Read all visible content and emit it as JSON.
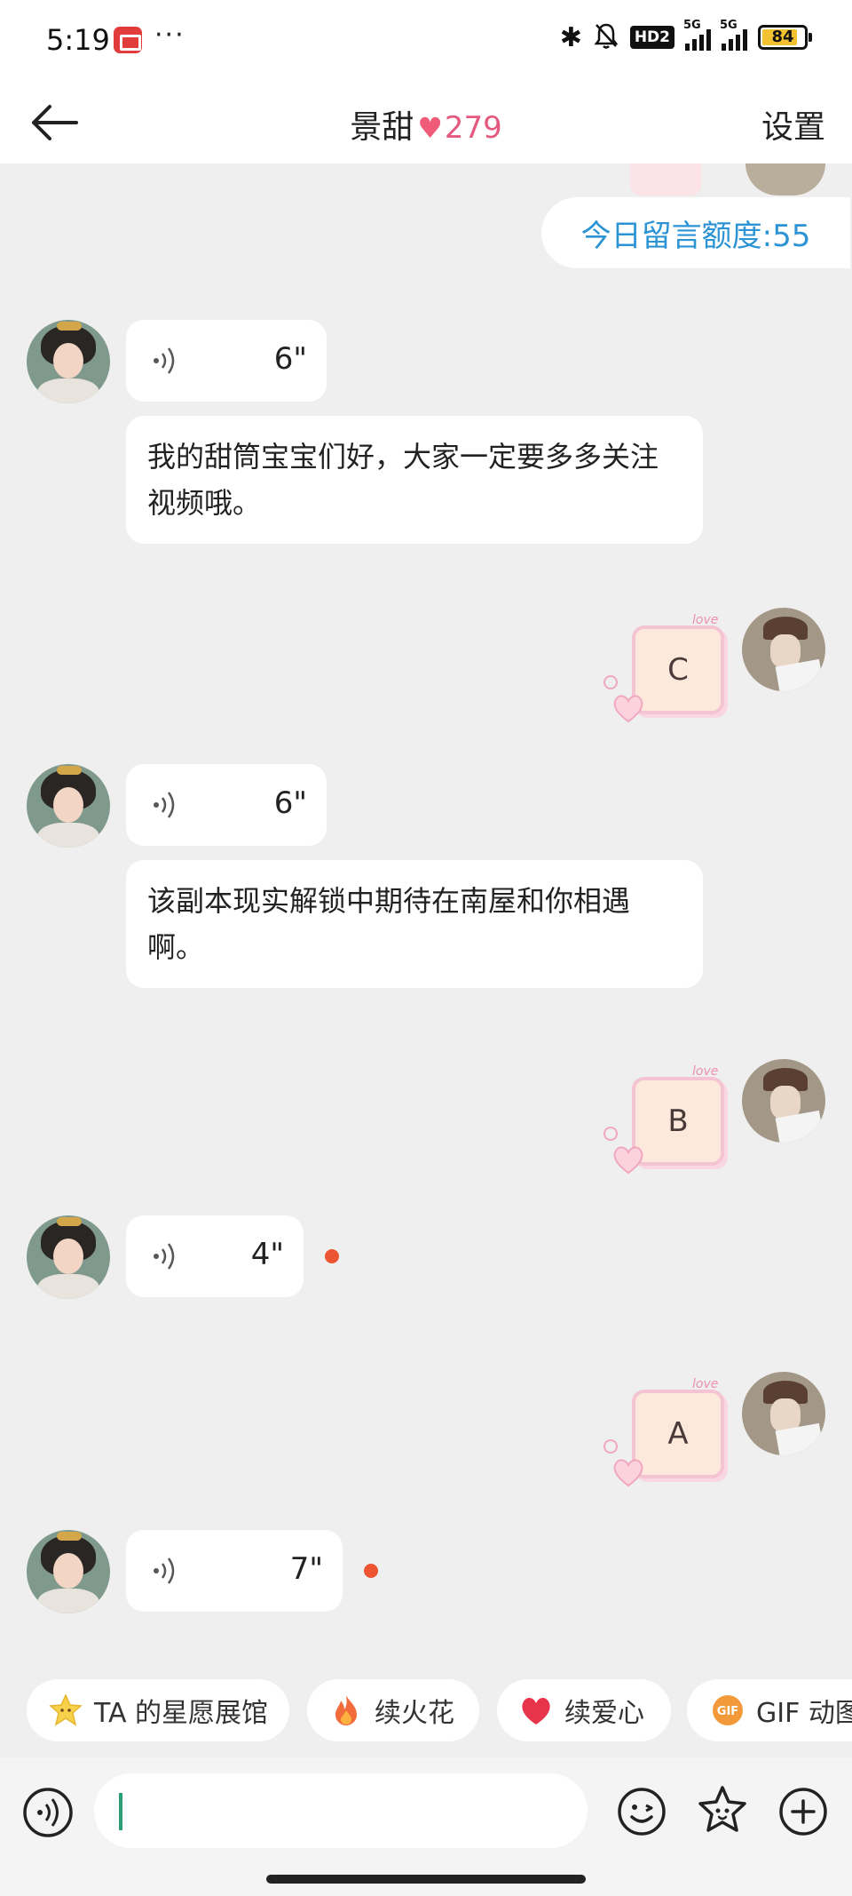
{
  "status_bar": {
    "time": "5:19",
    "dots": "···",
    "hd": "HD2",
    "net": "5G",
    "battery": "84",
    "battery_level": 0.84
  },
  "nav": {
    "title": "景甜",
    "heart_count": "279",
    "settings_label": "设置"
  },
  "quota": {
    "label": "今日留言额度:55"
  },
  "messages": [
    {
      "type": "voice",
      "side": "left",
      "duration": "6\""
    },
    {
      "type": "text",
      "side": "left",
      "text": "我的甜筒宝宝们好，大家一定要多多关注视频哦。"
    },
    {
      "type": "sticker",
      "side": "right",
      "letter": "C"
    },
    {
      "type": "voice",
      "side": "left",
      "duration": "6\""
    },
    {
      "type": "text",
      "side": "left",
      "text": "该副本现实解锁中期待在南屋和你相遇啊。"
    },
    {
      "type": "sticker",
      "side": "right",
      "letter": "B"
    },
    {
      "type": "voice",
      "side": "left",
      "duration": "4\"",
      "unread": true
    },
    {
      "type": "sticker",
      "side": "right",
      "letter": "A"
    },
    {
      "type": "voice",
      "side": "left",
      "duration": "7\"",
      "unread": true
    }
  ],
  "sticker_deco": "love",
  "quick_actions": [
    {
      "label": "TA 的星愿展馆",
      "icon": "star-icon"
    },
    {
      "label": "续火花",
      "icon": "fire-icon"
    },
    {
      "label": "续爱心",
      "icon": "heart-icon"
    },
    {
      "label": "GIF 动图",
      "icon": "gif-icon"
    }
  ],
  "colors": {
    "accent_blue": "#2c93d4",
    "heart_pink": "#f05b7a",
    "unread_dot": "#ec5432"
  }
}
